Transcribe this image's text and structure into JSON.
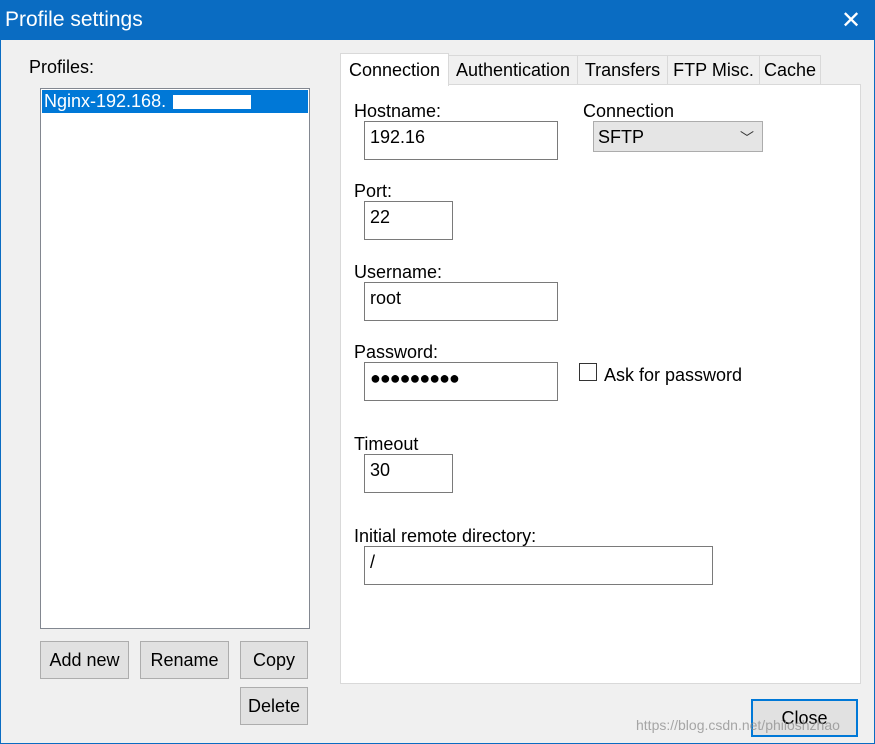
{
  "window": {
    "title": "Profile settings",
    "close_glyph": "✕"
  },
  "profiles": {
    "label": "Profiles:",
    "items": [
      {
        "name": "Nginx-192.168."
      }
    ]
  },
  "buttons": {
    "add_new": "Add new",
    "rename": "Rename",
    "copy": "Copy",
    "delete": "Delete",
    "close": "Close"
  },
  "tabs": [
    {
      "label": "Connection",
      "active": true
    },
    {
      "label": "Authentication"
    },
    {
      "label": "Transfers"
    },
    {
      "label": "FTP Misc."
    },
    {
      "label": "Cache"
    }
  ],
  "connection": {
    "hostname_label": "Hostname:",
    "hostname_value": "192.16",
    "connection_label": "Connection",
    "connection_value": "SFTP",
    "connection_chevron": "﹀",
    "port_label": "Port:",
    "port_value": "22",
    "username_label": "Username:",
    "username_value": "root",
    "password_label": "Password:",
    "password_value": "●●●●●●●●●",
    "ask_password_label": "Ask for password",
    "ask_password_checked": false,
    "timeout_label": "Timeout",
    "timeout_value": "30",
    "remote_dir_label": "Initial remote directory:",
    "remote_dir_value": "/"
  },
  "watermark": "https://blog.csdn.net/philoshzhao"
}
